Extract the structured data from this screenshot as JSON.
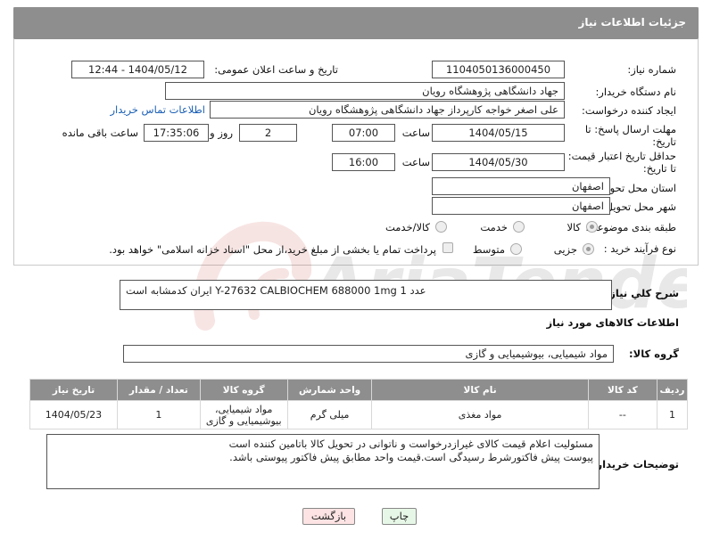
{
  "header": {
    "title": "جزئیات اطلاعات نیاز"
  },
  "form": {
    "need_number_label": "شماره نیاز:",
    "need_number": "1104050136000450",
    "announce_label": "تاریخ و ساعت اعلان عمومی:",
    "announce_value": "1404/05/12 - 12:44",
    "buyer_org_label": "نام دستگاه خریدار:",
    "buyer_org": "جهاد دانشگاهی پژوهشگاه رویان",
    "creator_label": "ایجاد کننده درخواست:",
    "creator": "علی اصغر خواجه کارپرداز جهاد دانشگاهی پژوهشگاه رویان",
    "contact_link": "اطلاعات تماس خریدار",
    "deadline_label_1": "مهلت ارسال پاسخ: تا",
    "deadline_label_2": "تاریخ:",
    "deadline_date": "1404/05/15",
    "time_label": "ساعت",
    "deadline_time": "07:00",
    "days_value": "2",
    "days_label": "روز و",
    "remaining_time": "17:35:06",
    "remaining_label": "ساعت باقی مانده",
    "price_validity_label_1": "حداقل تاریخ اعتبار قیمت:",
    "price_validity_label_2": "تا تاریخ:",
    "validity_date": "1404/05/30",
    "validity_time": "16:00",
    "province_label": "استان محل تحویل:",
    "province": "اصفهان",
    "city_label": "شهر محل تحویل:",
    "city": "اصفهان",
    "category_label": "طبقه بندی موضوعی:",
    "category_options": [
      "کالا",
      "خدمت",
      "کالا/خدمت"
    ],
    "process_label": "نوع فرآیند خرید :",
    "process_options": [
      "جزیی",
      "متوسط"
    ],
    "payment_note": "پرداخت تمام یا بخشی از مبلغ خرید،از محل \"اسناد خزانه اسلامی\" خواهد بود."
  },
  "description": {
    "label": "شرح کلي نياز:",
    "value": "ایران کدمشابه است  Y-27632     CALBIOCHEM      688000          1mg           1 عدد"
  },
  "goods_info": {
    "section_title": "اطلاعات کالاهای مورد نیاز",
    "group_label": "گروه کالا:",
    "group_value": "مواد شیمیایی، بیوشیمیایی و  گازی"
  },
  "table": {
    "headers": [
      "ردیف",
      "کد کالا",
      "نام کالا",
      "واحد شمارش",
      "گروه کالا",
      "تعداد / مقدار",
      "تاریخ نیاز"
    ],
    "rows": [
      [
        "1",
        "--",
        "مواد مغذی",
        "میلی گرم",
        "مواد شیمیایی، بیوشیمیایی و گازی",
        "1",
        "1404/05/23"
      ]
    ]
  },
  "buyer_notes": {
    "label": "توضیحات خریدار:",
    "line1": "مسئولیت اعلام قیمت کالای غیرازدرخواست و ناتوانی در تحویل کالا باتامین کننده است",
    "line2": "پیوست پیش فاکتورشرط رسیدگی است.قیمت واحد مطابق پیش فاکتور پیوستی باشد."
  },
  "buttons": {
    "print": "چاپ",
    "back": "بازگشت"
  },
  "watermark": {
    "text": "AriaTender.neT"
  },
  "colors": {
    "header_bg": "#8e8e8e",
    "link": "#1a5fb4",
    "back_bg": "#fde3e3",
    "print_bg": "#e7f7e7"
  }
}
